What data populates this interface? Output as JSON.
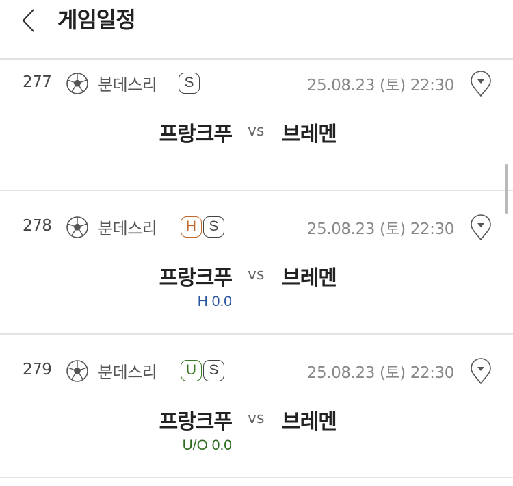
{
  "header": {
    "title": "게임일정"
  },
  "matches": [
    {
      "no": "277",
      "league": "분데스리",
      "badges": [
        "S"
      ],
      "datetime": "25.08.23 (토) 22:30",
      "home": "프랑크푸",
      "vs": "vs",
      "away": "브레멘",
      "odds": ""
    },
    {
      "no": "278",
      "league": "분데스리",
      "badges": [
        "H",
        "S"
      ],
      "datetime": "25.08.23 (토) 22:30",
      "home": "프랑크푸",
      "vs": "vs",
      "away": "브레멘",
      "odds": "H 0.0"
    },
    {
      "no": "279",
      "league": "분데스리",
      "badges": [
        "U",
        "S"
      ],
      "datetime": "25.08.23 (토) 22:30",
      "home": "프랑크푸",
      "vs": "vs",
      "away": "브레멘",
      "odds": "U/O 0.0"
    }
  ],
  "colors": {
    "handicap": "#c0672a",
    "underover": "#3a7a26",
    "odds_blue": "#2a55a0",
    "odds_green": "#2f6a22"
  },
  "icons": {
    "back": "chevron-left-icon",
    "sport": "soccer-ball-icon",
    "pin": "location-pin-icon"
  }
}
